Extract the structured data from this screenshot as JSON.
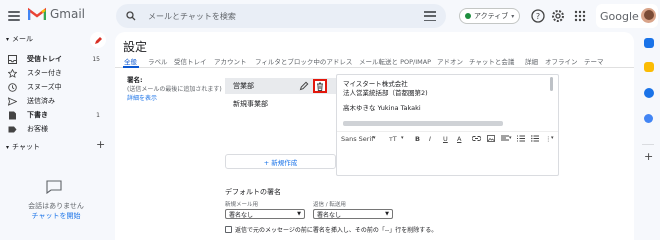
{
  "app": {
    "name": "Gmail"
  },
  "search": {
    "placeholder": "メールとチャットを検索"
  },
  "status": {
    "label": "アクティブ"
  },
  "brand": {
    "google": "Google"
  },
  "colors": {
    "accent": "#0b57d0",
    "highlight_box": "#e3170b",
    "active_dot": "#1e8e3e"
  },
  "sidebar": {
    "mail_section": "メール",
    "items": [
      {
        "label": "受信トレイ",
        "count": "15",
        "icon": "inbox-icon",
        "bold": true
      },
      {
        "label": "スター付き",
        "count": "",
        "icon": "star-icon"
      },
      {
        "label": "スヌーズ中",
        "count": "",
        "icon": "clock-icon"
      },
      {
        "label": "送信済み",
        "count": "",
        "icon": "send-icon"
      },
      {
        "label": "下書き",
        "count": "1",
        "icon": "draft-icon",
        "bold": true
      },
      {
        "label": "お客様",
        "count": "",
        "icon": "label-icon"
      }
    ],
    "chat_section": "チャット",
    "chat_empty": "会話はありません",
    "chat_start": "チャットを開始"
  },
  "settings": {
    "title": "設定",
    "tabs": [
      "全般",
      "ラベル",
      "受信トレイ",
      "アカウント",
      "フィルタとブロック中のアドレス",
      "メール転送と POP/IMAP",
      "アドオン",
      "チャットと会議",
      "詳細",
      "オフライン",
      "テーマ"
    ],
    "signature": {
      "label": "署名:",
      "sub": "(送信メールの最後に追加されます)",
      "details": "詳細を表示",
      "list": [
        "営業部",
        "新規事業部"
      ],
      "editor_lines": [
        "マイスタート株式会社",
        "法人営業統括部（首都圏第2)",
        "高木ゆきな Yukina Takaki"
      ],
      "toolbar": {
        "font": "Sans Serif",
        "size": "тT",
        "bold": "B",
        "italic": "I",
        "underline": "U",
        "color": "A"
      },
      "new_button": "+ 新規作成"
    },
    "defaults": {
      "title": "デフォルトの署名",
      "new_mail_label": "新規メール用",
      "reply_label": "返信 / 転送用",
      "new_mail_value": "署名なし",
      "reply_value": "署名なし",
      "checkbox_text": "返信で元のメッセージの前に署名を挿入し、その前の「--」行を削除する。"
    }
  }
}
